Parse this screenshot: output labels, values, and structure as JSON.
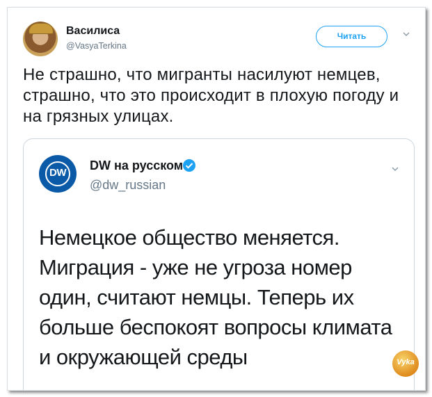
{
  "tweet": {
    "author_name": "Василиса",
    "author_handle": "@VasyaTerkina",
    "follow_label": "Читать",
    "text": "Не страшно, что мигранты насилуют немцев, страшно, что это происходит в плохую погоду и на грязных улицах."
  },
  "quoted": {
    "logo_text": "DW",
    "author_name": "DW на русском",
    "author_handle": "@dw_russian",
    "text": "Немецкое общество меняется. Миграция - уже не угроза номер один, считают немцы. Теперь их больше беспокоят вопросы климата и окружающей среды"
  },
  "watermark": {
    "text": "Vyka"
  },
  "colors": {
    "accent": "#1da1f2",
    "dw_blue": "#0a5aa8",
    "text": "#14171a",
    "muted": "#657786"
  }
}
